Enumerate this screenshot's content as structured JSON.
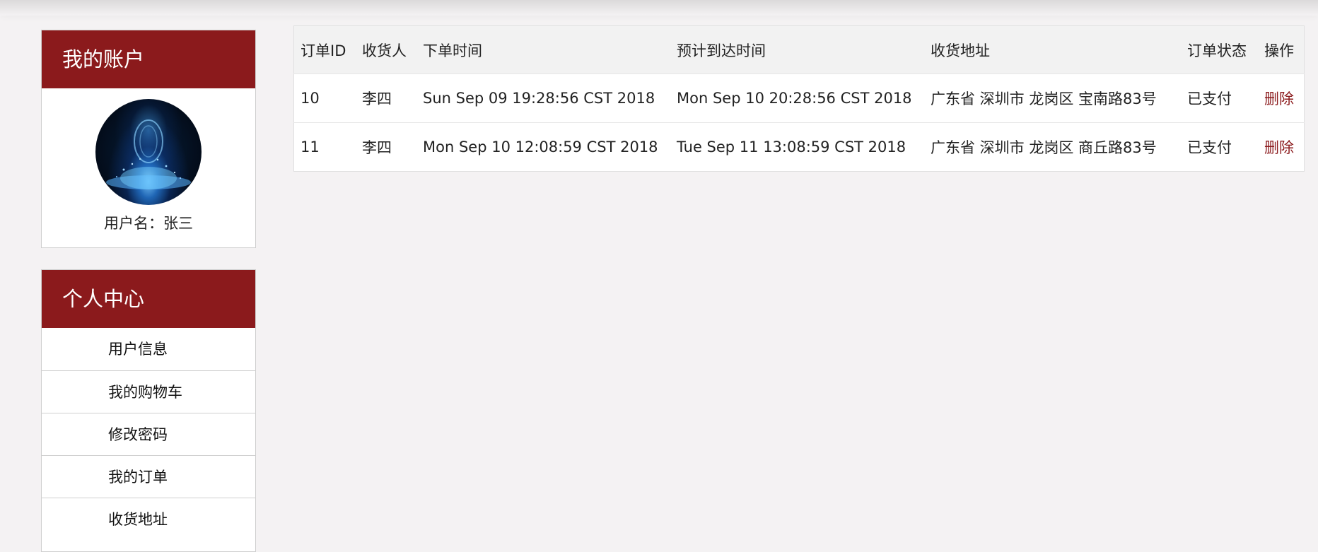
{
  "colors": {
    "accent": "#8b1a1c",
    "page_bg": "#f4f2f3"
  },
  "account": {
    "title": "我的账户",
    "username_text": "用户名：张三"
  },
  "personal_center": {
    "title": "个人中心",
    "items": [
      {
        "label": "用户信息"
      },
      {
        "label": "我的购物车"
      },
      {
        "label": "修改密码"
      },
      {
        "label": "我的订单"
      },
      {
        "label": "收货地址"
      }
    ]
  },
  "orders": {
    "headers": {
      "id": "订单ID",
      "receiver": "收货人",
      "order_time": "下单时间",
      "eta": "预计到达时间",
      "address": "收货地址",
      "status": "订单状态",
      "operation": "操作"
    },
    "rows": [
      {
        "id": "10",
        "receiver": "李四",
        "order_time": "Sun Sep 09 19:28:56 CST 2018",
        "eta": "Mon Sep 10 20:28:56 CST 2018",
        "address": "广东省 深圳市 龙岗区 宝南路83号",
        "status": "已支付",
        "action": "删除"
      },
      {
        "id": "11",
        "receiver": "李四",
        "order_time": "Mon Sep 10 12:08:59 CST 2018",
        "eta": "Tue Sep 11 13:08:59 CST 2018",
        "address": "广东省 深圳市 龙岗区 商丘路83号",
        "status": "已支付",
        "action": "删除"
      }
    ]
  }
}
